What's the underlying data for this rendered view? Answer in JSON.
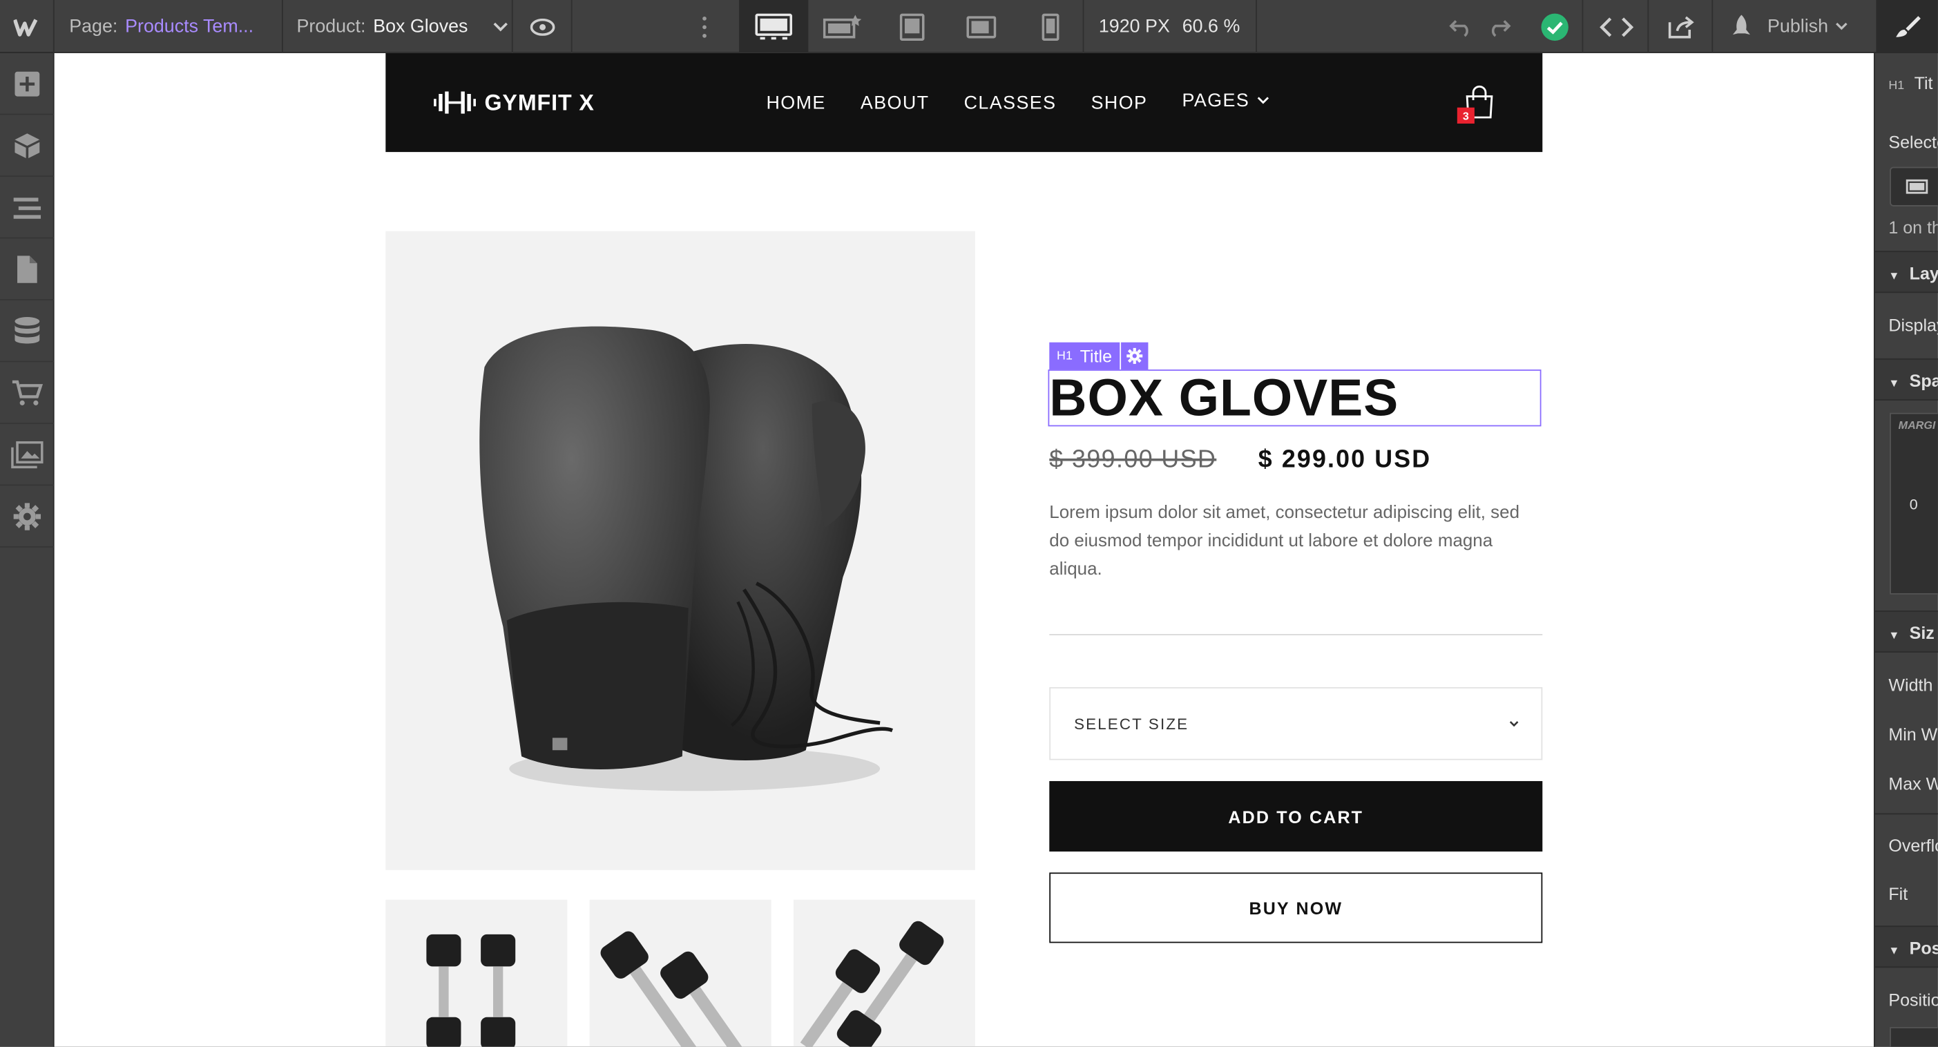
{
  "toolbar": {
    "logo": "W",
    "page_key": "Page:",
    "page_value": "Products Tem...",
    "product_key": "Product:",
    "product_value": "Box Gloves",
    "canvas_width": "1920 PX",
    "zoom": "60.6 %",
    "publish_label": "Publish",
    "breakpoints": [
      "desktop-icon",
      "large-desktop-icon",
      "tablet-icon",
      "mobile-landscape-icon",
      "mobile-portrait-icon"
    ]
  },
  "sidebar": {
    "icons": [
      "add-icon",
      "components-icon",
      "navigator-icon",
      "pages-icon",
      "cms-icon",
      "ecommerce-icon",
      "assets-icon",
      "settings-icon"
    ]
  },
  "right_panel": {
    "element_tag": "H1",
    "element_label": "Tit",
    "selector_label": "Selecto",
    "on_this_page": "1 on th",
    "sections": [
      "Lay",
      "Spa",
      "Siz",
      "Pos"
    ],
    "display_label": "Display",
    "margin_label": "MARGI",
    "margin_value": "0",
    "width_label": "Width",
    "min_width_label": "Min W",
    "max_width_label": "Max W",
    "overflow_label": "Overflo",
    "fit_label": "Fit",
    "position_label": "Positio"
  },
  "site": {
    "brand": "GYMFIT X",
    "nav": [
      "HOME",
      "ABOUT",
      "CLASSES",
      "SHOP"
    ],
    "nav_pages": "PAGES",
    "cart_count": "3"
  },
  "product": {
    "selection_tag": "H1",
    "selection_label": "Title",
    "title": "BOX GLOVES",
    "old_price": "$ 399.00 USD",
    "price": "$ 299.00 USD",
    "description": "Lorem ipsum dolor sit amet, consectetur adipiscing elit, sed do eiusmod tempor incididunt ut labore et dolore magna aliqua.",
    "select_placeholder": "SELECT SIZE",
    "add_to_cart": "ADD TO CART",
    "buy_now": "BUY NOW"
  },
  "colors": {
    "accent": "#8a6cff",
    "success": "#2bb673",
    "badge": "#e9222f"
  }
}
